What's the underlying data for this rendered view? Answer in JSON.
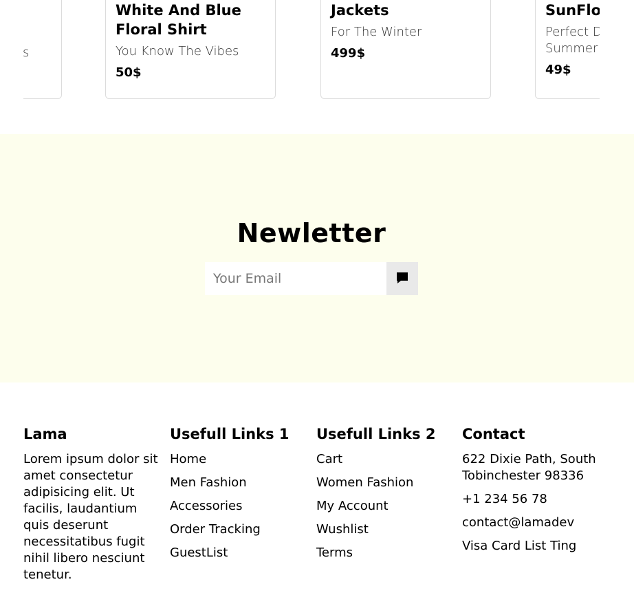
{
  "products": [
    {
      "title": "",
      "subtitle": "s",
      "price": ""
    },
    {
      "title": "White And Blue Floral Shirt",
      "subtitle": "You Know The Vibes",
      "price": "50$"
    },
    {
      "title": "Jackets",
      "subtitle": "For The Winter",
      "price": "499$"
    },
    {
      "title": "SunFlow",
      "subtitle": "Perfect D Summer!",
      "price": "49$"
    }
  ],
  "newsletter": {
    "title": "Newletter",
    "email_placeholder": "Your Email",
    "send_icon": "chat-bubble-icon",
    "background": "#fdfeed"
  },
  "footer": {
    "brand": {
      "title": "Lama",
      "description": "Lorem ipsum dolor sit amet consectetur adipisicing elit. Ut facilis, laudantium quis deserunt necessitatibus fugit nihil libero nesciunt tenetur."
    },
    "links1": {
      "title": "Usefull Links 1",
      "items": [
        "Home",
        "Men Fashion",
        "Accessories",
        "Order Tracking",
        "GuestList"
      ]
    },
    "links2": {
      "title": "Usefull Links 2",
      "items": [
        "Cart",
        "Women Fashion",
        "My Account",
        "Wushlist",
        "Terms"
      ]
    },
    "contact": {
      "title": "Contact",
      "address": "622 Dixie Path, South Tobinchester 98336",
      "phone": "+1 234 56 78",
      "email": "contact@lamadev",
      "payment": "Visa Card List Ting"
    }
  }
}
